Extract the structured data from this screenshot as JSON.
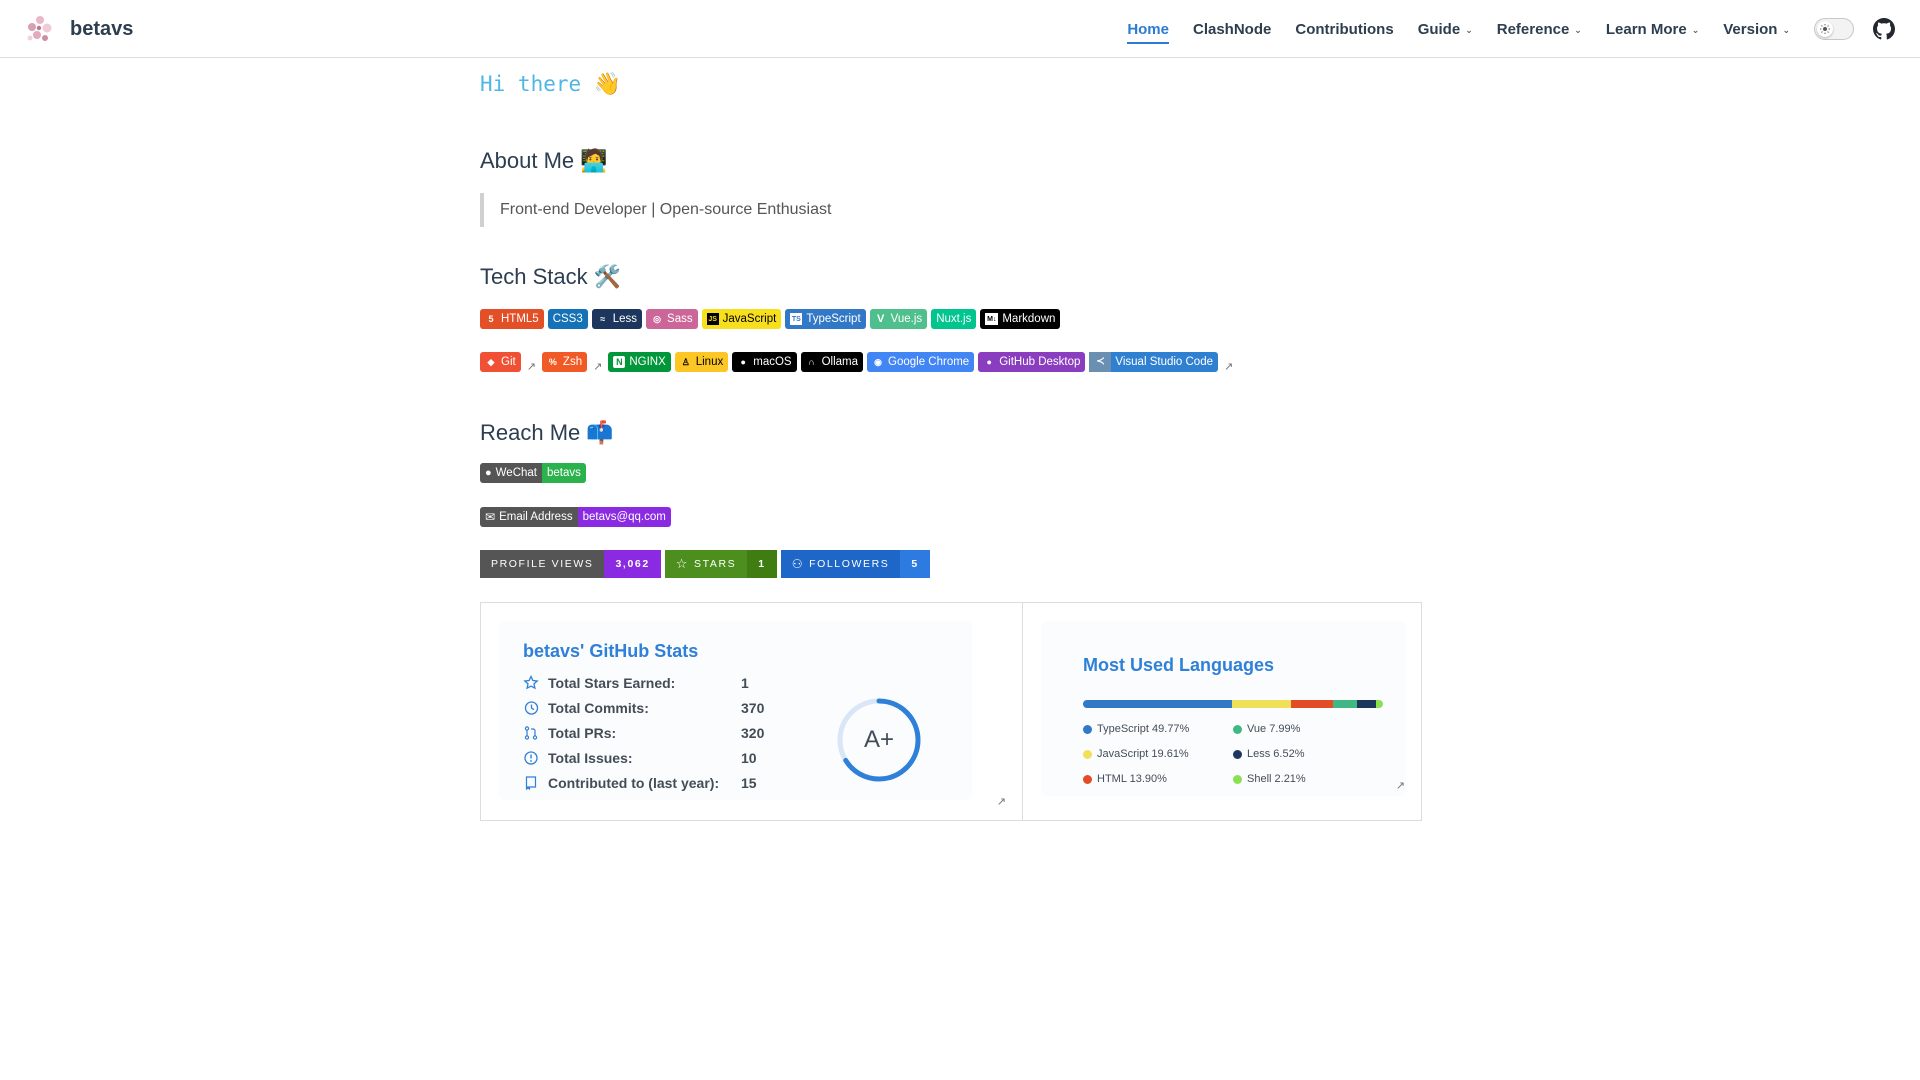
{
  "brand": {
    "name": "betavs"
  },
  "nav": {
    "items": [
      {
        "label": "Home"
      },
      {
        "label": "ClashNode"
      },
      {
        "label": "Contributions"
      },
      {
        "label": "Guide"
      },
      {
        "label": "Reference"
      },
      {
        "label": "Learn More"
      },
      {
        "label": "Version"
      }
    ]
  },
  "greeting": "Hi there",
  "sections": {
    "about": {
      "title": "About Me",
      "quote": "Front-end Developer | Open-source Enthusiast"
    },
    "tech": {
      "title": "Tech Stack"
    },
    "reach": {
      "title": "Reach Me"
    }
  },
  "tech_badges": {
    "row1": [
      {
        "label": "HTML5",
        "color": "#e34f26"
      },
      {
        "label": "CSS3",
        "color": "#1572b6"
      },
      {
        "label": "Less",
        "color": "#1d365d"
      },
      {
        "label": "Sass",
        "color": "#cc6699"
      },
      {
        "label": "JavaScript",
        "color": "#f7df1e",
        "text": "#000000"
      },
      {
        "label": "TypeScript",
        "color": "#3178c6"
      },
      {
        "label": "Vue.js",
        "color": "#4fc08d"
      },
      {
        "label": "Nuxt.js",
        "color": "#00c58e"
      },
      {
        "label": "Markdown",
        "color": "#000000"
      }
    ],
    "row2": [
      {
        "label": "Git",
        "color": "#f05033"
      },
      {
        "label": "Zsh",
        "color": "#f15a24"
      },
      {
        "label": "NGINX",
        "color": "#009639"
      },
      {
        "label": "Linux",
        "color": "#fcc624",
        "text": "#000000"
      },
      {
        "label": "macOS",
        "color": "#000000"
      },
      {
        "label": "Ollama",
        "color": "#000000"
      },
      {
        "label": "Google Chrome",
        "color": "#4285f4"
      },
      {
        "label": "GitHub Desktop",
        "color": "#8a3ebf"
      },
      {
        "label": "Visual Studio Code",
        "color": "#2f80d0"
      }
    ]
  },
  "contact": {
    "wechat": {
      "label": "WeChat",
      "value": "betavs",
      "color": "#2bb24c"
    },
    "email": {
      "label": "Email Address",
      "value": "betavs@qq.com",
      "color": "#8a2be2"
    }
  },
  "counters": {
    "views": {
      "label": "PROFILE VIEWS",
      "value": "3,062"
    },
    "stars": {
      "label": "STARS",
      "value": "1"
    },
    "followers": {
      "label": "FOLLOWERS",
      "value": "5"
    }
  },
  "github_stats": {
    "title": "betavs' GitHub Stats",
    "rows": [
      {
        "label": "Total Stars Earned:",
        "value": "1",
        "icon": "star-icon"
      },
      {
        "label": "Total Commits:",
        "value": "370",
        "icon": "history-icon"
      },
      {
        "label": "Total PRs:",
        "value": "320",
        "icon": "pull-request-icon"
      },
      {
        "label": "Total Issues:",
        "value": "10",
        "icon": "issue-icon"
      },
      {
        "label": "Contributed to (last year):",
        "value": "15",
        "icon": "repo-icon"
      }
    ],
    "grade": "A+"
  },
  "languages": {
    "title": "Most Used Languages",
    "items": [
      {
        "name": "TypeScript",
        "percent": 49.77,
        "label": "TypeScript 49.77%",
        "color": "#3178c6"
      },
      {
        "name": "JavaScript",
        "percent": 19.61,
        "label": "JavaScript 19.61%",
        "color": "#f1e05a"
      },
      {
        "name": "HTML",
        "percent": 13.9,
        "label": "HTML 13.90%",
        "color": "#e34c26"
      },
      {
        "name": "Vue",
        "percent": 7.99,
        "label": "Vue 7.99%",
        "color": "#41b883"
      },
      {
        "name": "Less",
        "percent": 6.52,
        "label": "Less 6.52%",
        "color": "#1d365d"
      },
      {
        "name": "Shell",
        "percent": 2.21,
        "label": "Shell 2.21%",
        "color": "#89e051"
      }
    ]
  }
}
